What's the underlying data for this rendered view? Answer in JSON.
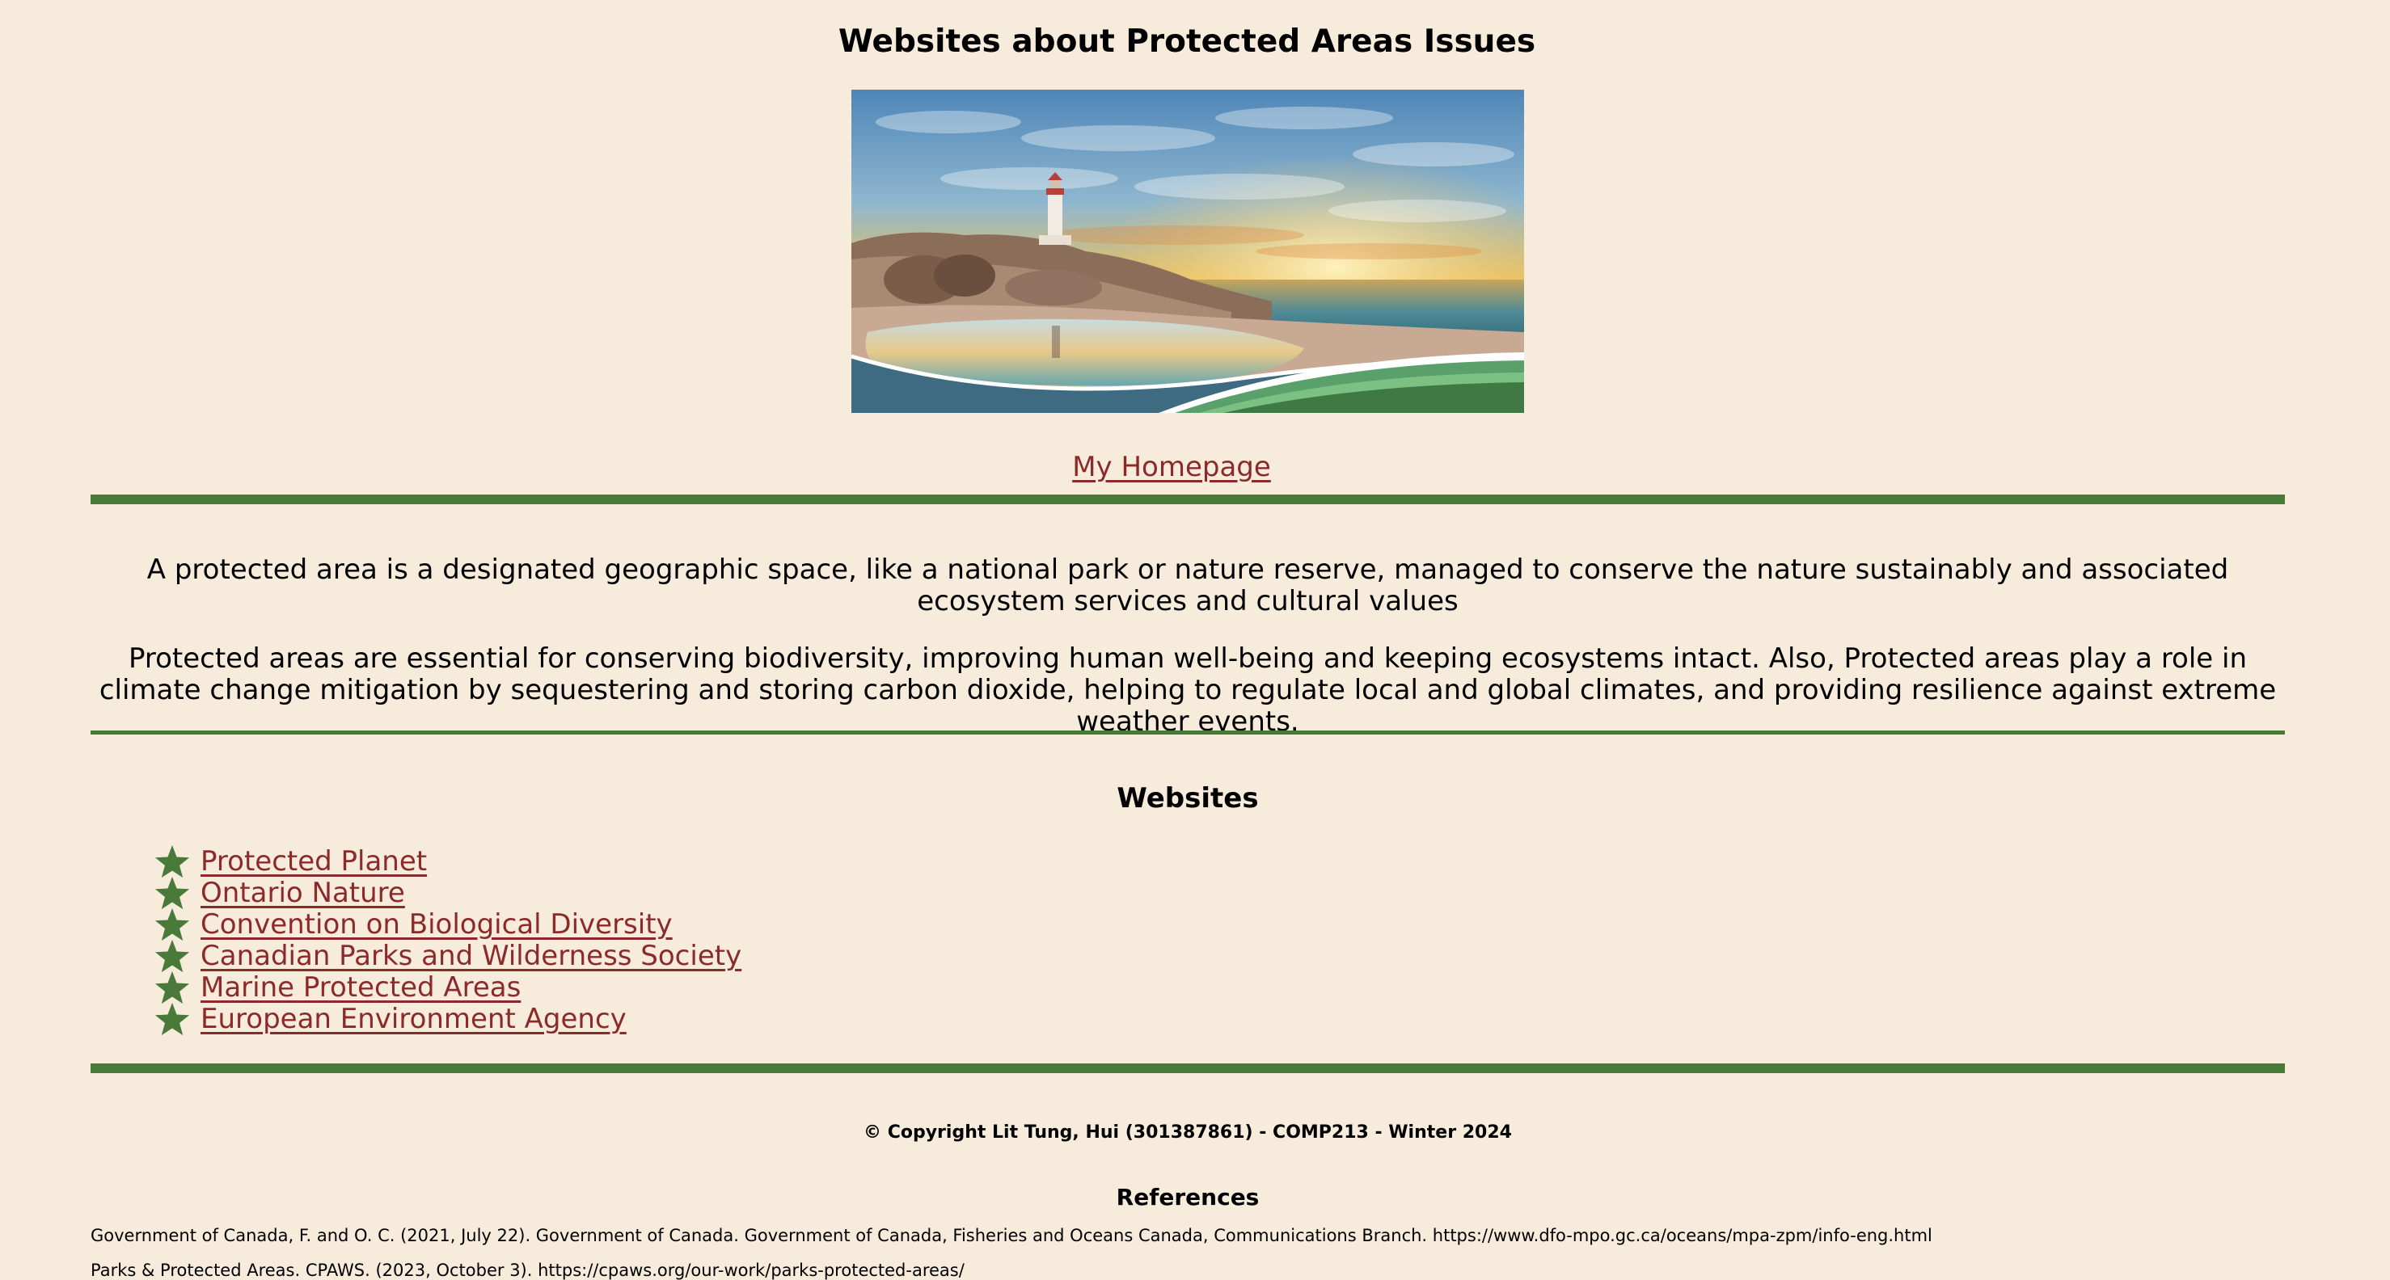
{
  "page": {
    "title": "Websites about Protected Areas Issues",
    "hero_image_alt": "Lighthouse on rocky coast at sunset"
  },
  "nav": {
    "homepage_link": "My Homepage"
  },
  "intro": {
    "paragraph_1": "A protected area is a designated geographic space, like a national park or nature reserve, managed to conserve the nature sustainably and associated ecosystem services and cultural values",
    "paragraph_2": "Protected areas are essential for conserving biodiversity, improving human well-being and keeping ecosystems intact. Also, Protected areas play a role in climate change mitigation by sequestering and storing carbon dioxide, helping to regulate local and global climates, and providing resilience against extreme weather events."
  },
  "websites": {
    "heading": "Websites",
    "bullet_icon": "star-icon",
    "links": [
      "Protected Planet",
      "Ontario Nature",
      "Convention on Biological Diversity",
      "Canadian Parks and Wilderness Society",
      "Marine Protected Areas",
      "European Environment Agency"
    ]
  },
  "footer": {
    "copyright": "© Copyright Lit Tung, Hui (301387861) - COMP213 - Winter 2024",
    "references_heading": "References",
    "references": [
      "Government of Canada, F. and O. C. (2021, July 22). Government of Canada. Government of Canada, Fisheries and Oceans Canada, Communications Branch. https://www.dfo-mpo.gc.ca/oceans/mpa-zpm/info-eng.html",
      "Parks & Protected Areas. CPAWS. (2023, October 3). https://cpaws.org/our-work/parks-protected-areas/"
    ]
  },
  "colors": {
    "background": "#f7ecdc",
    "accent_green": "#4a7a3a",
    "link": "#8c2a2a"
  }
}
